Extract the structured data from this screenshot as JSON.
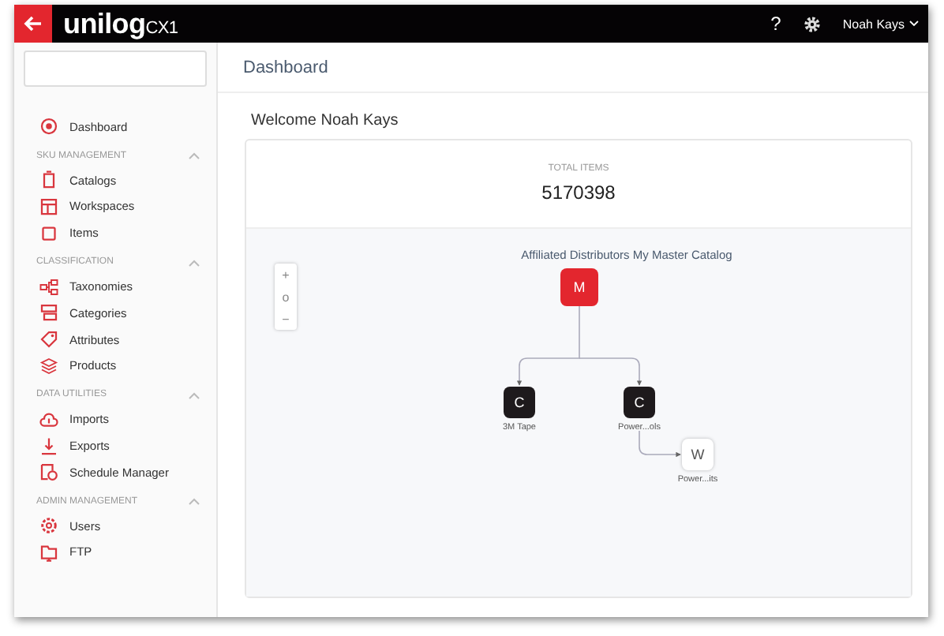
{
  "topbar": {
    "logo": "unilog",
    "logo_suffix": "CX1",
    "help": "?",
    "user": "Noah Kays"
  },
  "sidebar": {
    "top_item": {
      "label": "Dashboard",
      "kind": "dashboard"
    },
    "sections": [
      {
        "title": "SKU MANAGEMENT",
        "expanded": true,
        "items": [
          {
            "label": "Catalogs",
            "kind": "catalog"
          },
          {
            "label": "Workspaces",
            "kind": "table"
          },
          {
            "label": "Items",
            "kind": "square"
          }
        ]
      },
      {
        "title": "CLASSIFICATION",
        "expanded": true,
        "items": [
          {
            "label": "Taxonomies",
            "kind": "tree"
          },
          {
            "label": "Categories",
            "kind": "layers"
          },
          {
            "label": "Attributes",
            "kind": "tag"
          },
          {
            "label": "Products",
            "kind": "stack"
          }
        ]
      },
      {
        "title": "DATA UTILITIES",
        "expanded": true,
        "items": [
          {
            "label": "Imports",
            "kind": "cloud"
          },
          {
            "label": "Exports",
            "kind": "download"
          },
          {
            "label": "Schedule Manager",
            "kind": "clock"
          }
        ]
      },
      {
        "title": "ADMIN MANAGEMENT",
        "expanded": true,
        "items": [
          {
            "label": "Users",
            "kind": "gear"
          },
          {
            "label": "FTP",
            "kind": "folder"
          }
        ]
      }
    ]
  },
  "page_title": "Dashboard",
  "welcome": "Welcome Noah Kays",
  "total": {
    "label": "TOTAL ITEMS",
    "value": "5170398"
  },
  "diagram": {
    "zoom_controls": [
      "+",
      "o",
      "−"
    ],
    "title": "Affiliated Distributors My Master Catalog",
    "nodes": [
      {
        "letter": "M",
        "kind": "master"
      },
      {
        "letter": "C",
        "kind": "catalog",
        "label": "3M Tape"
      },
      {
        "letter": "C",
        "kind": "catalog",
        "label": "Power...ols"
      },
      {
        "letter": "W",
        "kind": "workspace",
        "label": "Power...its"
      }
    ]
  }
}
